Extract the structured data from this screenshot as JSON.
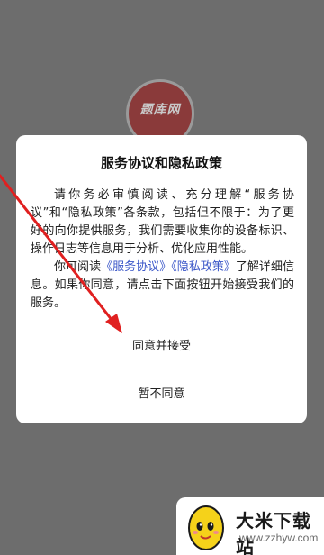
{
  "background": {
    "logo_text": "题库网",
    "overlay_color": "#6d6d6d"
  },
  "dialog": {
    "title": "服务协议和隐私政策",
    "paragraph1": "请你务必审慎阅读、充分理解“服务协议”和“隐私政策”各条款，包括但不限于：为了更好的向你提供服务，我们需要收集你的设备标识、操作日志等信息用于分析、优化应用性能。",
    "paragraph2_prefix": "你可阅读",
    "service_agreement_link": "《服务协议》",
    "privacy_policy_link": "《隐私政策》",
    "paragraph2_suffix": "了解详细信息。如果你同意，请点击下面按钮开始接受我们的服务。",
    "agree_button": "同意并接受",
    "disagree_button": "暂不同意",
    "link_color": "#3b57c8"
  },
  "annotation": {
    "arrow_color": "#e02020",
    "icon": "red-arrow-icon"
  },
  "watermark": {
    "title": "大米下载站",
    "url": "www.zzhyw.com",
    "mascot_icon": "rice-mascot-icon"
  }
}
